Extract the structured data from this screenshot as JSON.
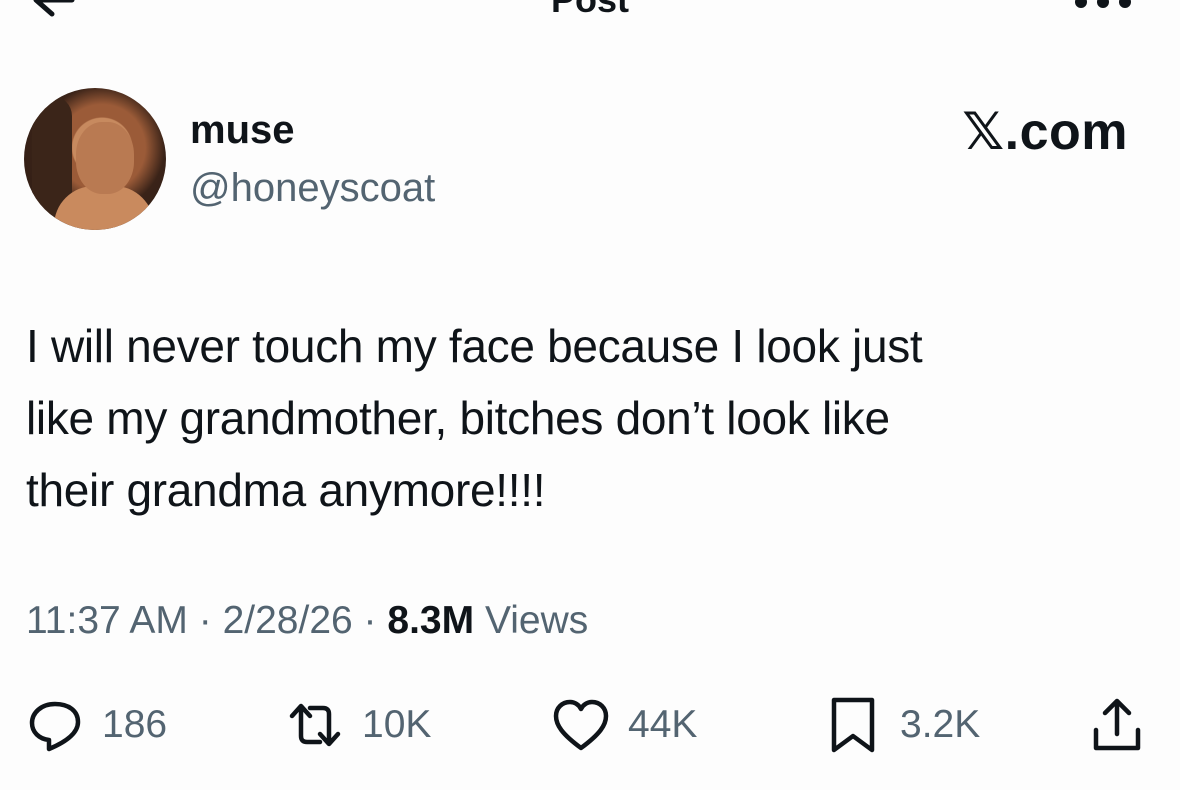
{
  "header": {
    "title": "Post"
  },
  "author": {
    "display_name": "muse",
    "handle": "@honeyscoat"
  },
  "brand": "𝕏.com",
  "tweet": {
    "lines": [
      "I will never touch my face because I look just",
      "like my grandmother, bitches don’t look like",
      "their grandma anymore!!!!"
    ]
  },
  "meta": {
    "time": "11:37 AM",
    "sep": "·",
    "date": "2/28/26",
    "views_count": "8.3M",
    "views_label": "Views"
  },
  "actions": {
    "replies": "186",
    "reposts": "10K",
    "likes": "44K",
    "bookmarks": "3.2K"
  },
  "icons": {
    "back": "back-arrow-icon",
    "more": "more-dots-icon",
    "reply": "reply-bubble-icon",
    "repost": "repost-icon",
    "like": "heart-icon",
    "bookmark": "bookmark-icon",
    "share": "share-icon"
  },
  "colors": {
    "text": "#0f1419",
    "secondary": "#536471",
    "background": "#fdfdfd"
  }
}
